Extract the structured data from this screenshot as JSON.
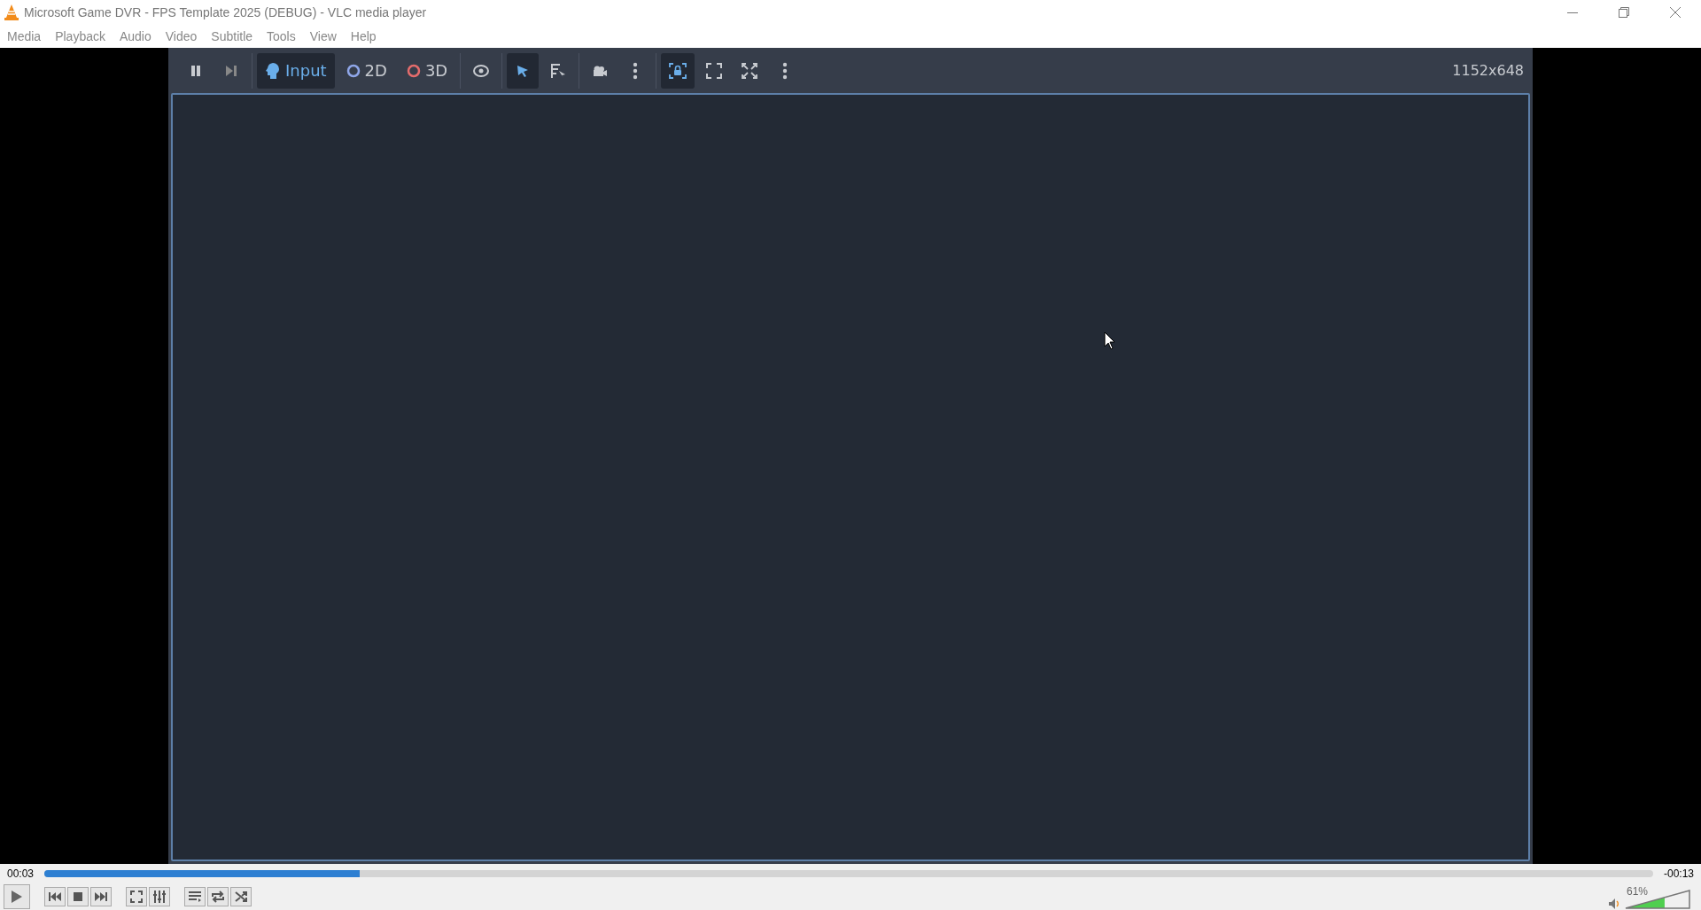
{
  "window": {
    "title": "Microsoft Game DVR - FPS Template 2025 (DEBUG) - VLC media player"
  },
  "menu": [
    "Media",
    "Playback",
    "Audio",
    "Video",
    "Subtitle",
    "Tools",
    "View",
    "Help"
  ],
  "game_toolbar": {
    "groups": [
      [
        {
          "kind": "pause",
          "selected": false
        },
        {
          "kind": "step",
          "selected": false
        }
      ],
      [
        {
          "kind": "input",
          "label": "Input",
          "selected": true
        },
        {
          "kind": "flat",
          "label": "2D",
          "selected": false
        },
        {
          "kind": "spatial",
          "label": "3D",
          "selected": false
        }
      ],
      [
        {
          "kind": "eye",
          "selected": false
        }
      ],
      [
        {
          "kind": "select",
          "selected": true
        },
        {
          "kind": "list-select",
          "selected": false
        }
      ],
      [
        {
          "kind": "camera",
          "selected": false
        },
        {
          "kind": "more",
          "selected": false
        }
      ],
      [
        {
          "kind": "lock",
          "selected": true
        },
        {
          "kind": "expand",
          "selected": false
        },
        {
          "kind": "fullscreen",
          "selected": false
        },
        {
          "kind": "more",
          "selected": false
        }
      ]
    ],
    "resolution": "1152x648"
  },
  "player": {
    "elapsed": "00:03",
    "remaining": "-00:13",
    "level": 0.196,
    "controls": [
      {
        "kind": "play"
      },
      {
        "kind": "gap"
      },
      {
        "kind": "prev"
      },
      {
        "kind": "stop"
      },
      {
        "kind": "next"
      },
      {
        "kind": "gap"
      },
      {
        "kind": "fullscreen"
      },
      {
        "kind": "effects"
      },
      {
        "kind": "gap"
      },
      {
        "kind": "playlist"
      },
      {
        "kind": "loop"
      },
      {
        "kind": "shuffle"
      }
    ],
    "volume": {
      "reading": "61%",
      "level": 0.61
    }
  }
}
